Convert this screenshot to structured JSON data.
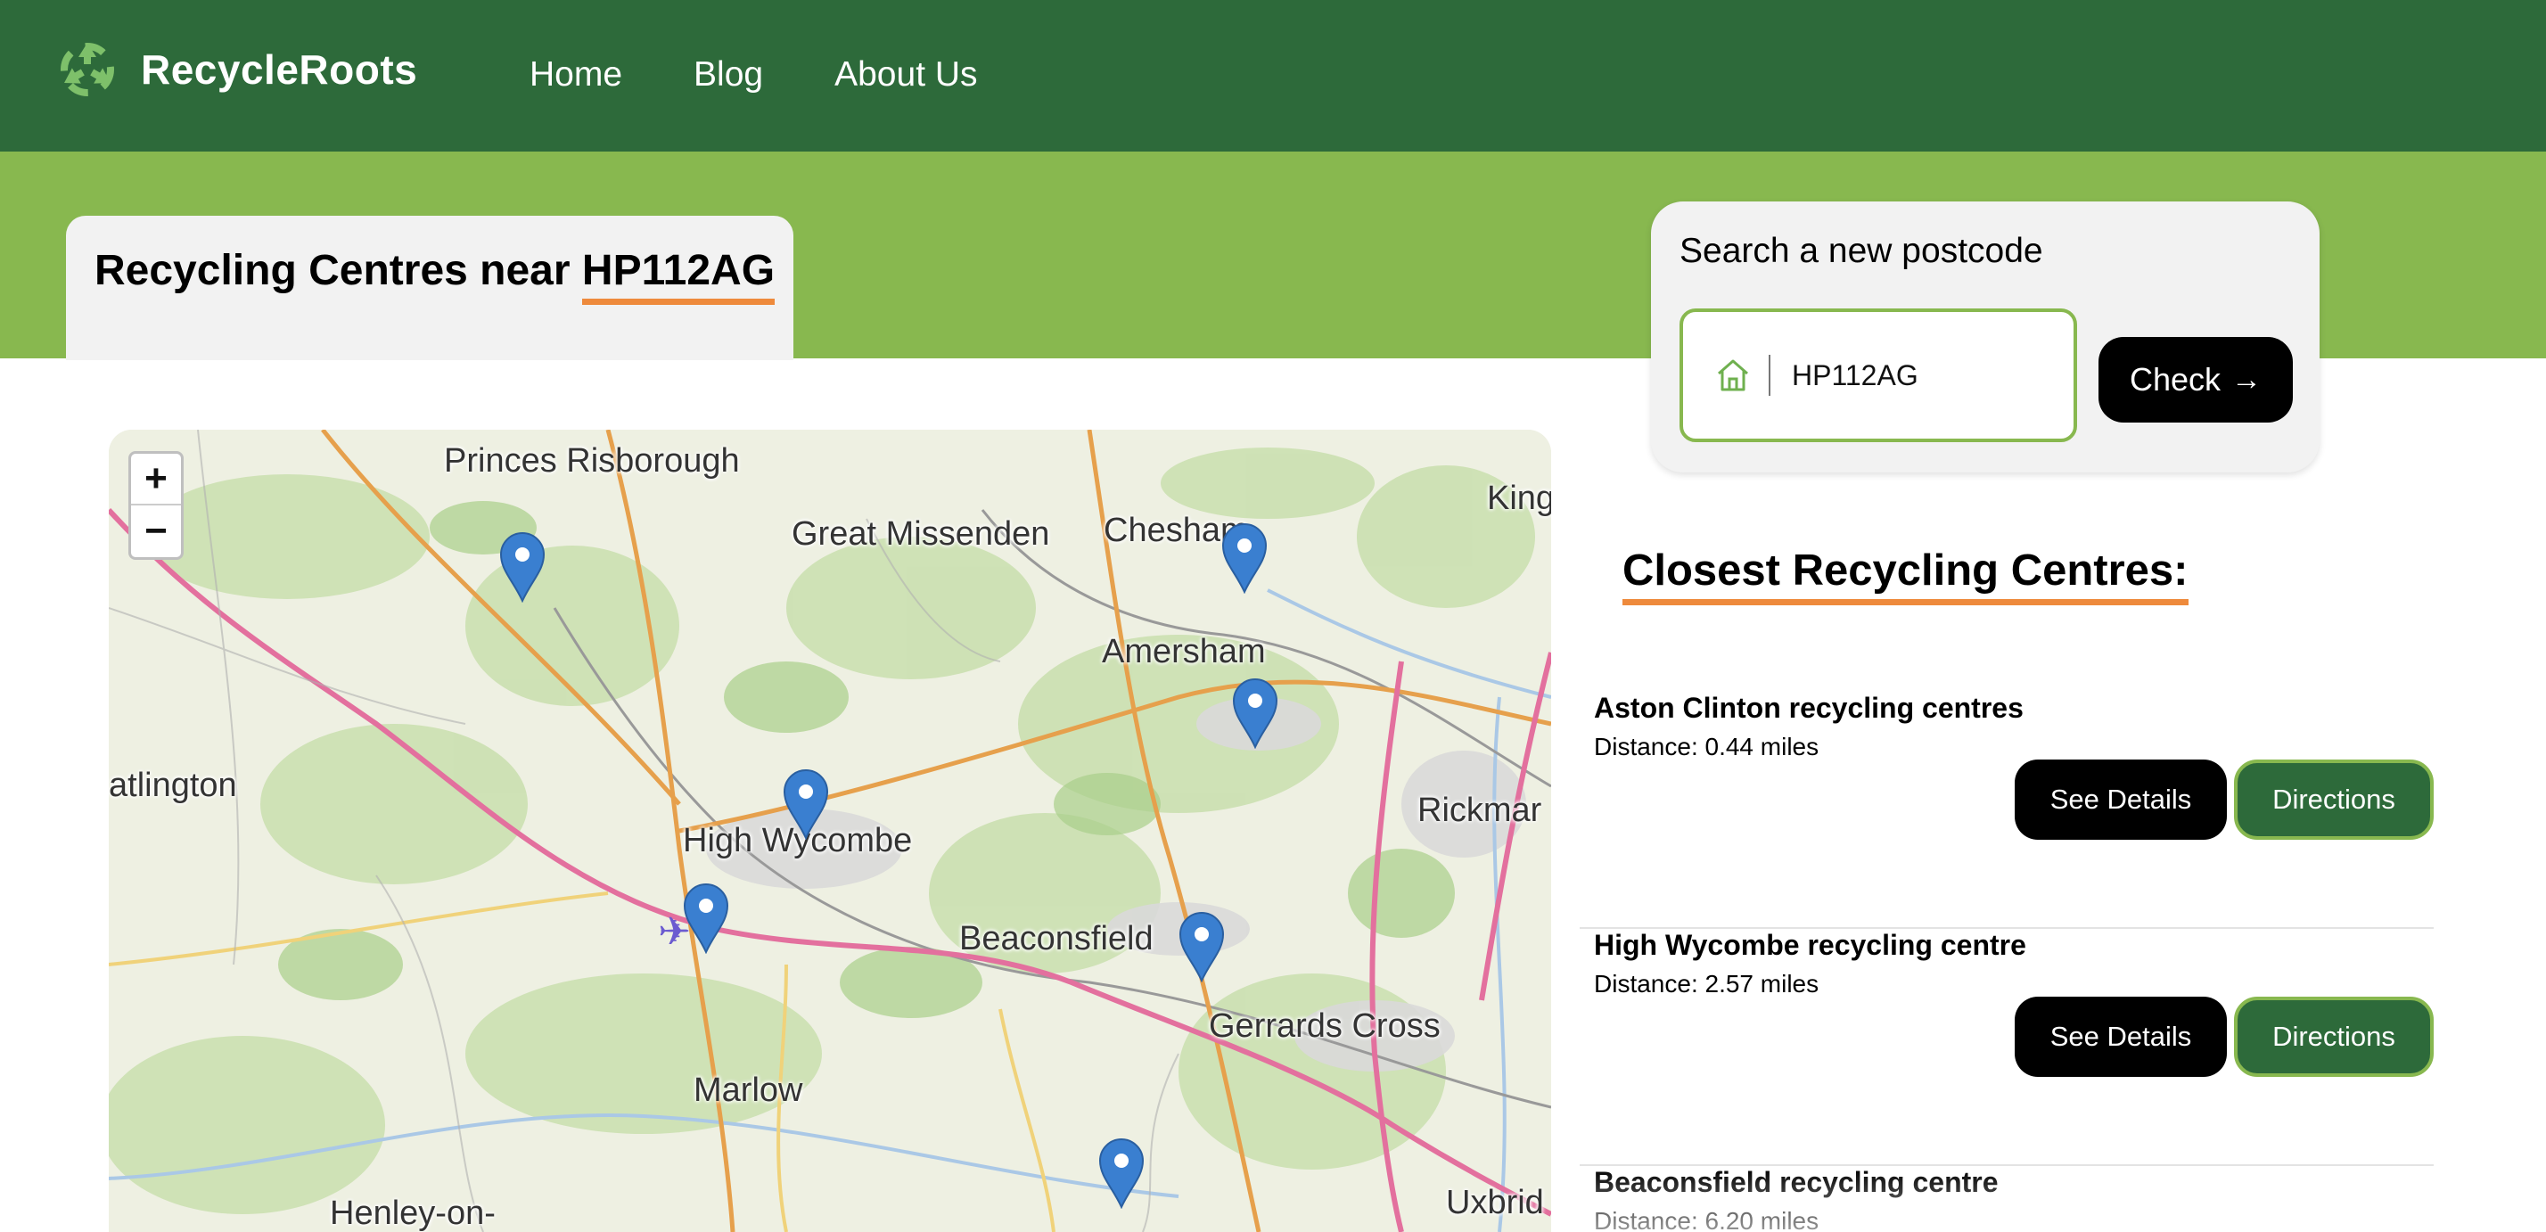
{
  "header": {
    "brand": "RecycleRoots",
    "logo_icon": "recycle-icon",
    "nav": [
      "Home",
      "Blog",
      "About Us"
    ],
    "colors": {
      "dark_green": "#2d6a3a",
      "light_green": "#88b84f",
      "accent_orange": "#ee8a3c"
    }
  },
  "page_title": {
    "prefix": "Recycling Centres near",
    "postcode": "HP112AG"
  },
  "search": {
    "label": "Search a new postcode",
    "input_value": "HP112AG",
    "input_icon": "home-icon",
    "check_label": "Check",
    "check_icon": "arrow-right-icon"
  },
  "map": {
    "zoom_in": "+",
    "zoom_out": "−",
    "places": [
      "Princes Risborough",
      "Great Missenden",
      "Chesham",
      "Amersham",
      "King",
      "atlington",
      "High Wycombe",
      "Rickmar",
      "Beaconsfield",
      "Gerrards Cross",
      "Marlow",
      "Henley-on-",
      "Uxbrid"
    ],
    "marker_icon": "map-pin-icon",
    "marker_color": "#3a7fd0"
  },
  "results": {
    "heading": "Closest Recycling Centres:",
    "items": [
      {
        "name": "Aston Clinton recycling centres",
        "distance": "Distance: 0.44 miles",
        "details_label": "See Details",
        "directions_label": "Directions"
      },
      {
        "name": "High Wycombe recycling centre",
        "distance": "Distance: 2.57 miles",
        "details_label": "See Details",
        "directions_label": "Directions"
      },
      {
        "name": "Beaconsfield recycling centre",
        "distance": "Distance: 6.20 miles"
      }
    ]
  }
}
